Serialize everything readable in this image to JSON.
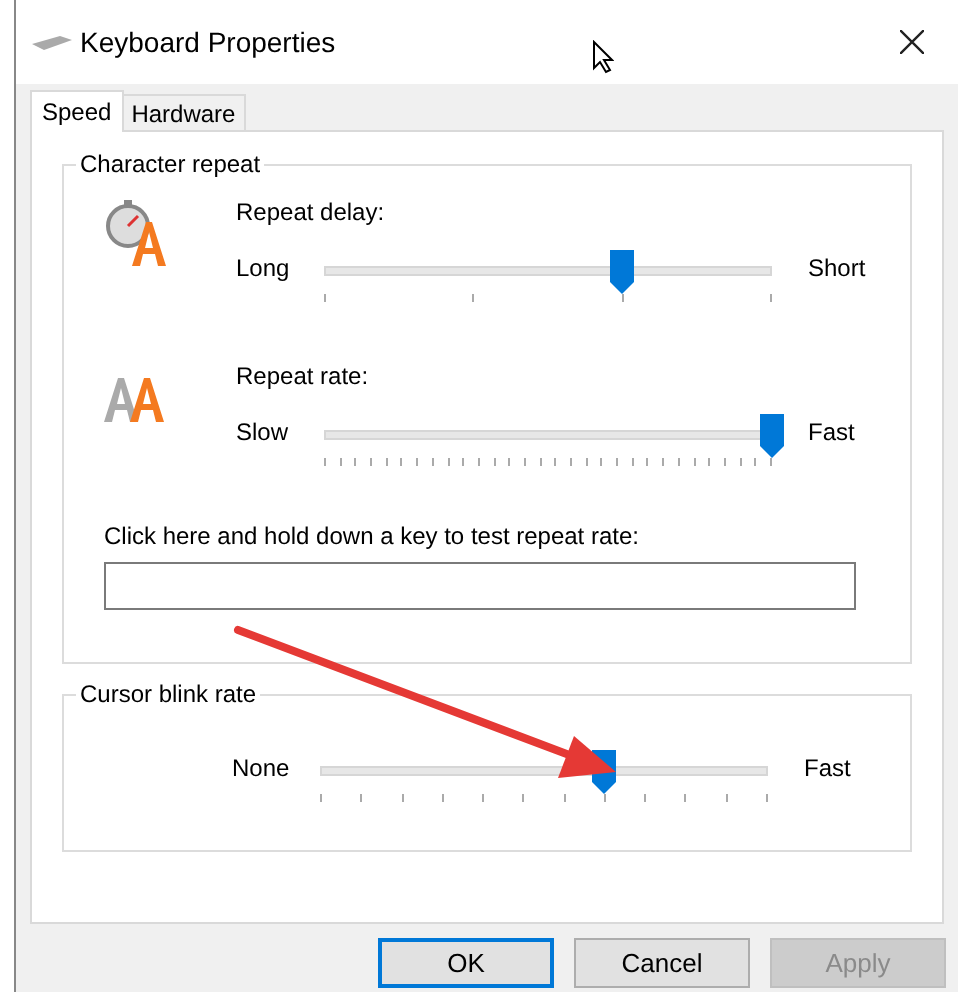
{
  "window": {
    "title": "Keyboard Properties"
  },
  "tabs": [
    {
      "label": "Speed",
      "selected": true
    },
    {
      "label": "Hardware",
      "selected": false
    }
  ],
  "character_repeat": {
    "title": "Character repeat",
    "sliders": [
      {
        "label": "Repeat delay:",
        "min_label": "Long",
        "max_label": "Short",
        "level": 0.667
      },
      {
        "label": "Repeat rate:",
        "min_label": "Slow",
        "max_label": "Fast",
        "level": 1.0
      }
    ],
    "test_field": {
      "label": "Click here and hold down a key to test repeat rate:"
    }
  },
  "cursor_blink": {
    "title": "Cursor blink rate",
    "min_label": "None",
    "max_label": "Fast",
    "level": 0.636
  },
  "buttons": [
    {
      "label": "OK",
      "default": true,
      "disabled": false
    },
    {
      "label": "Cancel",
      "default": false,
      "disabled": false
    },
    {
      "label": "Apply",
      "default": false,
      "disabled": true
    }
  ]
}
